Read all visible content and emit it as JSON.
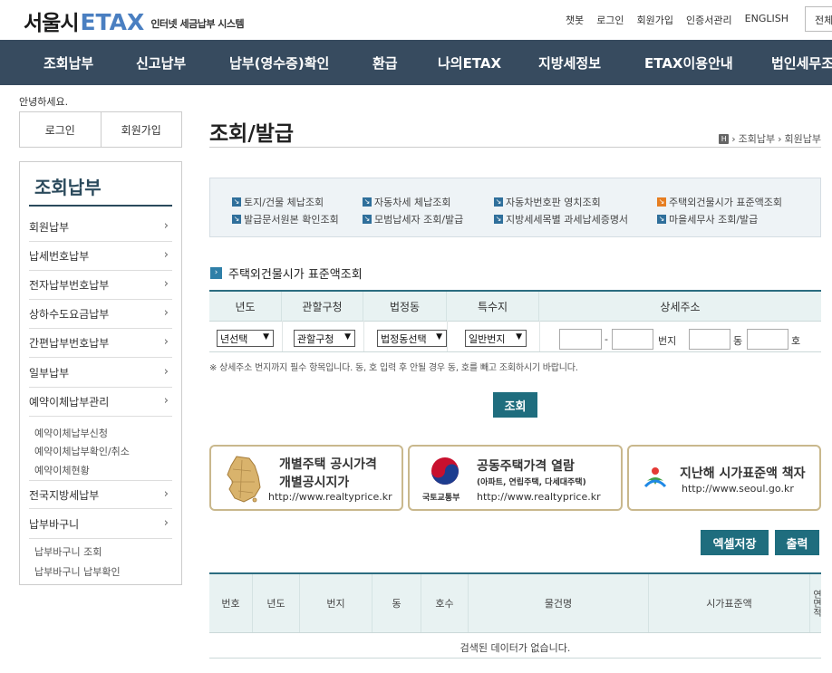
{
  "header": {
    "logo_seoul": "서울시",
    "logo_etax": "ETAX",
    "logo_sub": "인터넷 세금납부 시스템",
    "util": [
      "챗봇",
      "로그인",
      "회원가입",
      "인증서관리",
      "ENGLISH"
    ],
    "allmenu": "전체"
  },
  "gnb": [
    "조회납부",
    "신고납부",
    "납부(영수증)확인",
    "환급",
    "나의ETAX",
    "지방세정보",
    "ETAX이용안내",
    "법인세무조"
  ],
  "sidebar": {
    "hello": "안녕하세요.",
    "login": "로그인",
    "join": "회원가입",
    "title": "조회납부",
    "items": [
      "회원납부",
      "납세번호납부",
      "전자납부번호납부",
      "상하수도요금납부",
      "간편납부번호납부",
      "일부납부",
      "예약이체납부관리",
      "전국지방세납부",
      "납부바구니"
    ],
    "sub_reserve": [
      "예약이체납부신청",
      "예약이체납부확인/취소",
      "예약이체현황"
    ],
    "sub_basket": [
      "납부바구니 조회",
      "납부바구니 납부확인"
    ]
  },
  "main": {
    "title": "조회/발급",
    "breadcrumb": [
      "조회납부",
      "회원납부"
    ],
    "quick_links": [
      "토지/건물 체납조회",
      "자동차세 체납조회",
      "자동차번호판 영치조회",
      "주택외건물시가 표준액조회",
      "발급문서원본 확인조회",
      "모범납세자 조회/발급",
      "지방세세목별 과세납세증명서",
      "마을세무사 조회/발급"
    ],
    "section_title": "주택외건물시가 표준액조회",
    "search_headers": [
      "년도",
      "관할구청",
      "법정동",
      "특수지",
      "상세주소"
    ],
    "select_year": "년선택",
    "select_gu": "관할구청",
    "select_dong": "법정동선택",
    "select_special": "일반번지",
    "addr_dash": "-",
    "addr_bunji": "번지",
    "addr_dong": "동",
    "addr_ho": "호",
    "note": "※ 상세주소 번지까지 필수 항목입니다. 동, 호 입력 후 안될 경우 동, 호를 빼고 조회하시기 바랍니다.",
    "search_btn": "조회",
    "banners": {
      "b1_line1": "개별주택 공시가격",
      "b1_line2": "개별공시지가",
      "b1_url": "http://www.realtyprice.kr",
      "b2_line1": "공동주택가격 열람",
      "b2_small": "(아파트, 연립주택, 다세대주택)",
      "b2_url": "http://www.realtyprice.kr",
      "b2_logo_text": "국토교통부",
      "b3_line1": "지난해 시가표준액 책자",
      "b3_url": "http://www.seoul.go.kr"
    },
    "excel_btn": "엑셀저장",
    "print_btn": "출력",
    "result_headers": [
      "번호",
      "년도",
      "번지",
      "동",
      "호수",
      "물건명",
      "시가표준액",
      "연면적"
    ],
    "result_empty": "검색된 데이터가 없습니다."
  },
  "colors": {
    "gnb_bg": "#374b5f",
    "accent": "#1f6d7e",
    "logo_blue": "#4a7fc1",
    "banner_border": "#c9b88d"
  }
}
